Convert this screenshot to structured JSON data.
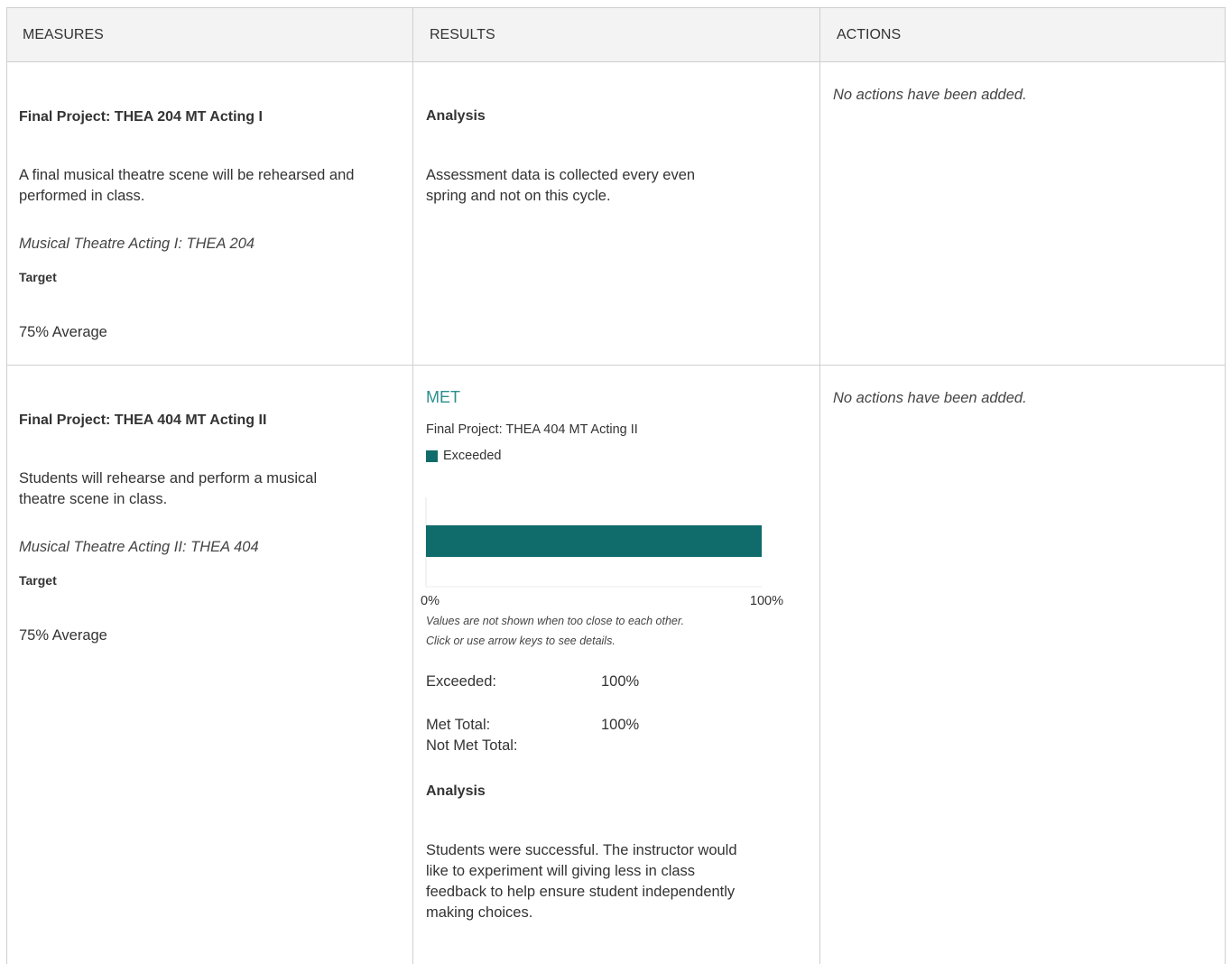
{
  "header": {
    "columns": [
      "MEASURES",
      "RESULTS",
      "ACTIONS"
    ]
  },
  "rows": [
    {
      "measure": {
        "title": "Final Project: THEA 204 MT Acting I",
        "description_lines": [
          "A final musical theatre scene will be rehearsed and",
          "performed in class."
        ],
        "course": "Musical Theatre Acting I: THEA 204",
        "target_label": "Target",
        "target_value": "75% Average"
      },
      "results": {
        "analysis_label": "Analysis",
        "analysis_lines": [
          "Assessment data is collected every even",
          "spring and not on this cycle."
        ]
      },
      "actions": {
        "text": "No actions have been added."
      }
    },
    {
      "measure": {
        "title": "Final Project: THEA 404 MT Acting II",
        "description_lines": [
          "Students will rehearse and perform a musical",
          "theatre scene in class."
        ],
        "course": "Musical Theatre Acting II: THEA 404",
        "target_label": "Target",
        "target_value": "75% Average"
      },
      "results": {
        "status": "MET",
        "status_color": "#2c8f8f",
        "chart_title": "Final Project: THEA 404 MT Acting II",
        "legend_label": "Exceeded",
        "bar_color": "#106b6b",
        "axis_min_label": "0%",
        "axis_max_label": "100%",
        "note_lines": [
          "Values are not shown when too close to each other.",
          "Click or use arrow keys to see details."
        ],
        "stats": {
          "exceeded_label": "Exceeded:",
          "exceeded_value": "100%",
          "met_total_label": "Met Total:",
          "met_total_value": "100%",
          "not_met_total_label": "Not Met Total:"
        },
        "analysis_label": "Analysis",
        "analysis_lines": [
          "Students were successful. The instructor would",
          "like to experiment will giving less in class",
          "feedback to help ensure student independently",
          "making choices."
        ]
      },
      "actions": {
        "text": "No actions have been added."
      }
    }
  ],
  "chart_data": {
    "type": "bar",
    "orientation": "horizontal",
    "title": "Final Project: THEA 404 MT Acting II",
    "categories": [
      "Final Project: THEA 404 MT Acting II"
    ],
    "series": [
      {
        "name": "Exceeded",
        "values": [
          100
        ]
      }
    ],
    "xlim": [
      0,
      100
    ],
    "x_tick_labels": [
      "0%",
      "100%"
    ],
    "legend": "top-left"
  }
}
